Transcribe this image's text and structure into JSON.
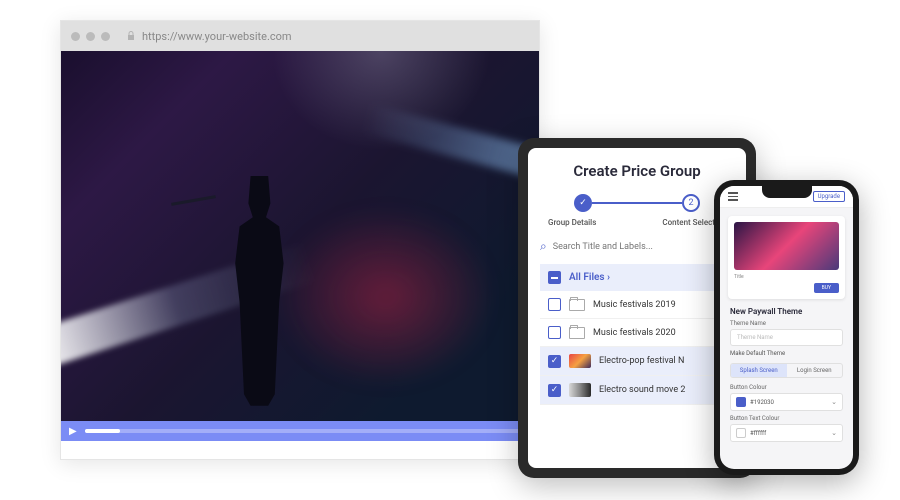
{
  "browser": {
    "url": "https://www.your-website.com"
  },
  "tablet": {
    "title": "Create Price Group",
    "steps": {
      "step1_label": "Group Details",
      "step2_label": "Content Selection",
      "step2_number": "2"
    },
    "search_placeholder": "Search Title and Labels...",
    "all_files_label": "All Files ›",
    "files": [
      {
        "name": "Music festivals 2019",
        "checked": false,
        "type": "folder"
      },
      {
        "name": "Music festivals 2020",
        "checked": false,
        "type": "folder"
      },
      {
        "name": "Electro-pop festival N",
        "checked": true,
        "type": "video"
      },
      {
        "name": "Electro sound move 2",
        "checked": true,
        "type": "video"
      }
    ]
  },
  "phone": {
    "upgrade_label": "Upgrade",
    "card_title_label": "Title",
    "card_buy_label": "BUY",
    "section_title": "New Paywall Theme",
    "theme_name_label": "Theme Name",
    "theme_name_placeholder": "Theme Name",
    "default_toggle_label": "Make Default Theme",
    "tabs": {
      "splash": "Splash Screen",
      "login": "Login Screen"
    },
    "button_colour_label": "Button Colour",
    "button_colour_value": "#192030",
    "button_text_colour_label": "Button Text Colour",
    "button_text_colour_value": "#ffffff"
  }
}
